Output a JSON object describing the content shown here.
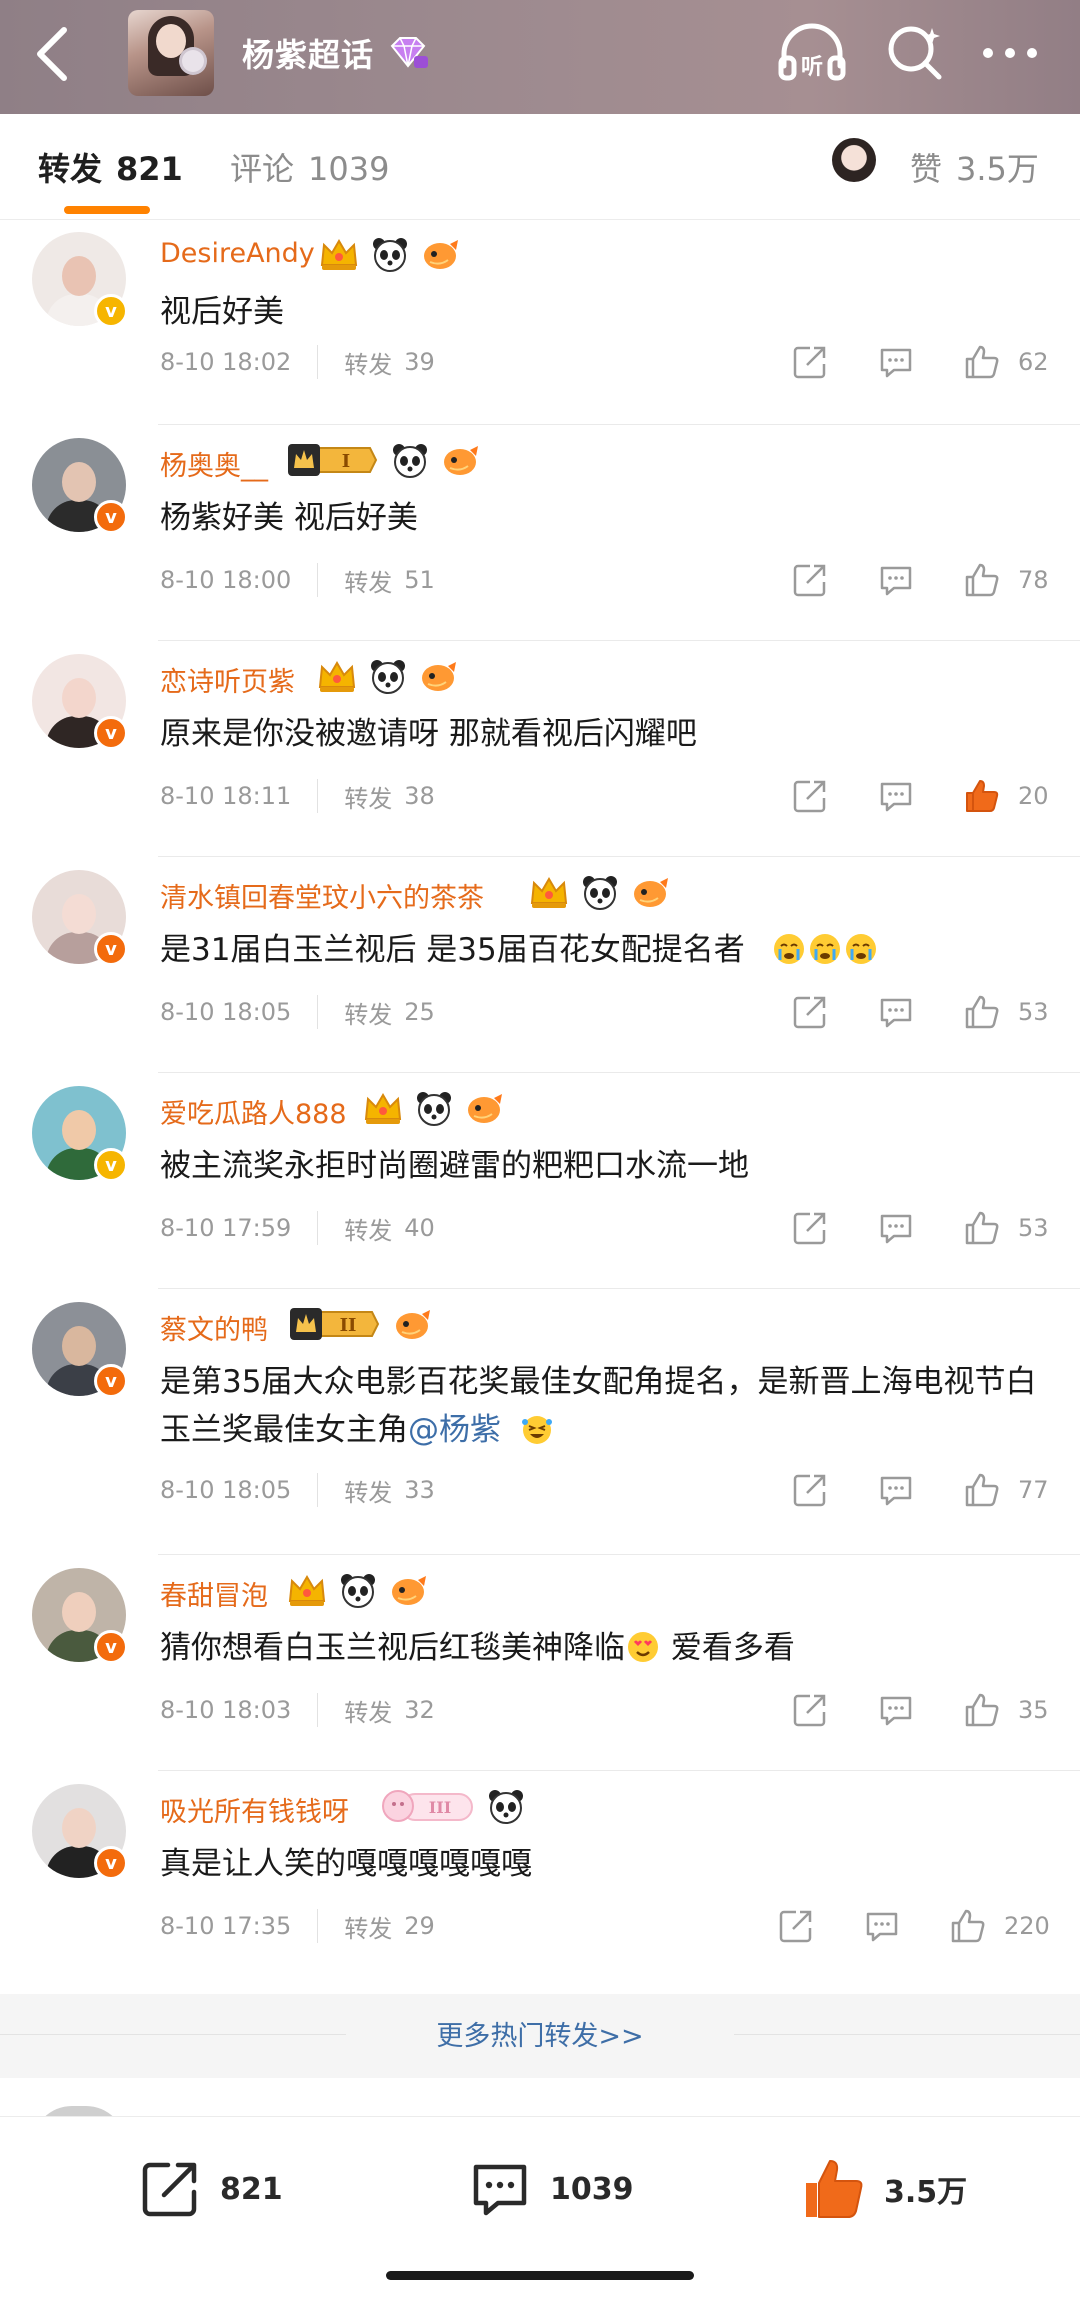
{
  "header": {
    "topic_title": "杨紫超话",
    "listen_label": "听"
  },
  "tabs": {
    "repost_label": "转发",
    "repost_count": "821",
    "comment_label": "评论",
    "comment_count": "1039",
    "like_label": "赞",
    "like_count": "3.5万"
  },
  "colors": {
    "accent": "#ff8200",
    "username": "#e56a1a",
    "link": "#3e6ea7",
    "liked": "#f06a1a"
  },
  "reposts": [
    {
      "user": "DesireAndy",
      "text": "视后好美",
      "time": "8-10 18:02",
      "repost_label": "转发",
      "repost_count": "39",
      "likes": "62"
    },
    {
      "user": "杨奥奥__",
      "text": "杨紫好美 视后好美",
      "time": "8-10 18:00",
      "repost_label": "转发",
      "repost_count": "51",
      "likes": "78"
    },
    {
      "user": "恋诗听页紫",
      "text": "原来是你没被邀请呀 那就看视后闪耀吧",
      "time": "8-10 18:11",
      "repost_label": "转发",
      "repost_count": "38",
      "likes": "20"
    },
    {
      "user": "清水镇回春堂玟小六的茶茶",
      "text": "是31届白玉兰视后 是35届百花女配提名者",
      "time": "8-10 18:05",
      "repost_label": "转发",
      "repost_count": "25",
      "likes": "53"
    },
    {
      "user": "爱吃瓜路人888",
      "text": "被主流奖永拒时尚圈避雷的粑粑口水流一地",
      "time": "8-10 17:59",
      "repost_label": "转发",
      "repost_count": "40",
      "likes": "53"
    },
    {
      "user": "蔡文的鸭",
      "text": "是第35届大众电影百花奖最佳女配角提名，是新晋上海电视节白玉兰奖最佳女主角",
      "mention": "@杨紫",
      "time": "8-10 18:05",
      "repost_label": "转发",
      "repost_count": "33",
      "likes": "77"
    },
    {
      "user": "春甜冒泡",
      "text": "猜你想看白玉兰视后红毯美神降临",
      "text_after": " 爱看多看",
      "time": "8-10 18:03",
      "repost_label": "转发",
      "repost_count": "32",
      "likes": "35"
    },
    {
      "user": "吸光所有钱钱呀",
      "text": "真是让人笑的嘎嘎嘎嘎嘎嘎",
      "time": "8-10 17:35",
      "repost_label": "转发",
      "repost_count": "29",
      "likes": "220"
    }
  ],
  "more_link": "更多热门转发>>",
  "bottom_bar": {
    "repost_count": "821",
    "comment_count": "1039",
    "like_count": "3.5万"
  }
}
